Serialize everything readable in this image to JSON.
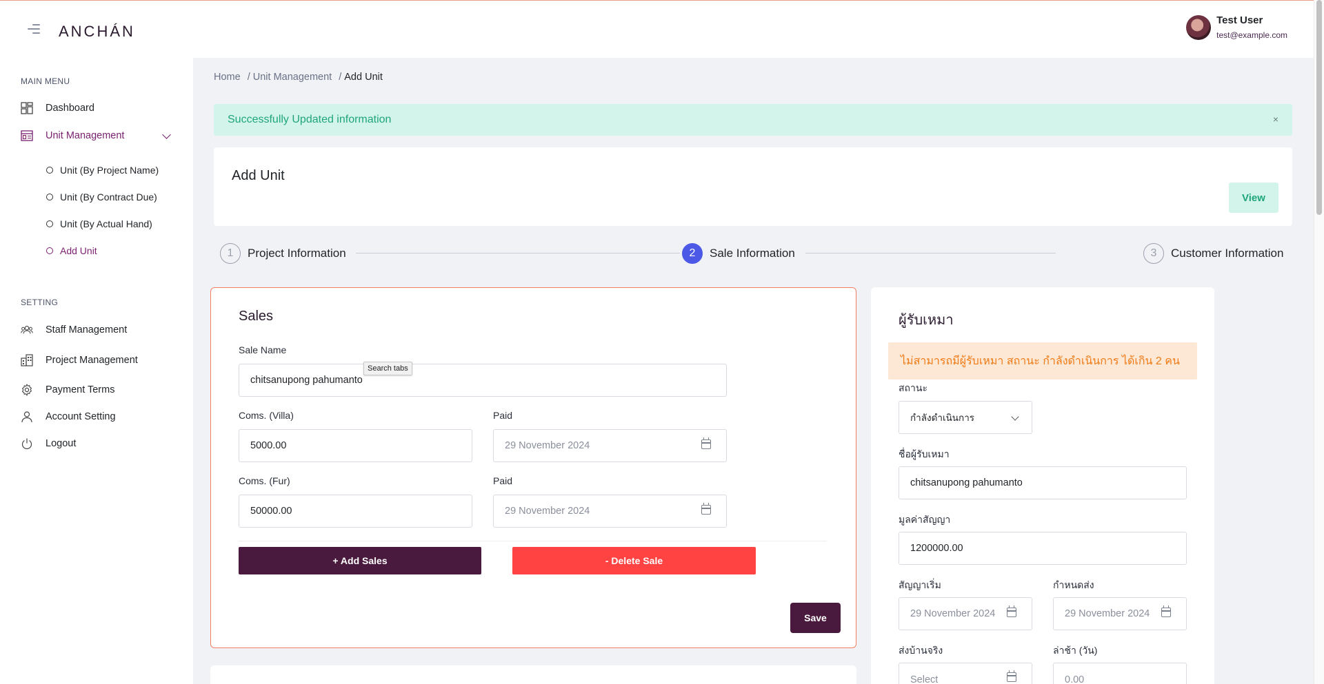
{
  "brand": {
    "logo": "ANCHÁN"
  },
  "user": {
    "name": "Test User",
    "email": "test@example.com"
  },
  "sidebar": {
    "main_menu_title": "MAIN MENU",
    "dashboard": "Dashboard",
    "unit_management": "Unit Management",
    "sub_items": [
      "Unit (By Project Name)",
      "Unit (By Contract Due)",
      "Unit (By Actual Hand)",
      "Add Unit"
    ],
    "setting_title": "SETTING",
    "staff_management": "Staff Management",
    "project_management": "Project Management",
    "payment_terms": "Payment Terms",
    "account_setting": "Account Setting",
    "logout": "Logout"
  },
  "breadcrumb": {
    "home": "Home",
    "unit_management": "Unit Management",
    "current": "Add Unit",
    "separator": "/"
  },
  "alert": {
    "message": "Successfully Updated information",
    "close": "×"
  },
  "page": {
    "title": "Add Unit",
    "view_button": "View"
  },
  "stepper": {
    "steps": [
      {
        "num": "1",
        "label": "Project Information"
      },
      {
        "num": "2",
        "label": "Sale Information"
      },
      {
        "num": "3",
        "label": "Customer Information"
      }
    ]
  },
  "sales": {
    "title": "Sales",
    "sale_name_label": "Sale Name",
    "sale_name_value": "chitsanupong pahumanto",
    "tooltip": "Search tabs",
    "coms_villa_label": "Coms. (Villa)",
    "coms_villa_value": "5000.00",
    "paid_label": "Paid",
    "paid_villa_date": "29 November 2024",
    "coms_fur_label": "Coms. (Fur)",
    "coms_fur_value": "50000.00",
    "paid_fur_date": "29 November 2024",
    "add_button": "+ Add Sales",
    "delete_button": "- Delete Sale",
    "save_button": "Save"
  },
  "contractor": {
    "title": "ผู้รับเหมา",
    "warning": "ไม่สามารถมีผู้รับเหมา สถานะ กำลังดำเนินการ ได้เกิน 2 คน",
    "status_label": "สถานะ",
    "status_value": "กำลังดำเนินการ",
    "name_label": "ชื่อผู้รับเหมา",
    "name_value": "chitsanupong pahumanto",
    "contract_value_label": "มูลค่าสัญญา",
    "contract_value": "1200000.00",
    "contract_start_label": "สัญญาเริ่ม",
    "contract_start_value": "29 November 2024",
    "due_label": "กำหนดส่ง",
    "due_value": "29 November 2024",
    "actual_delivery_label": "ส่งบ้านจริง",
    "actual_delivery_placeholder": "Select",
    "delay_label": "ล่าช้า (วัน)",
    "delay_placeholder": "0.00"
  },
  "colors": {
    "accent": "#4a1a3e",
    "active": "#7a1f6e",
    "success": "#1ea67a",
    "danger": "#ff4343",
    "step_active": "#4c58e6",
    "warning": "#f07a14"
  }
}
